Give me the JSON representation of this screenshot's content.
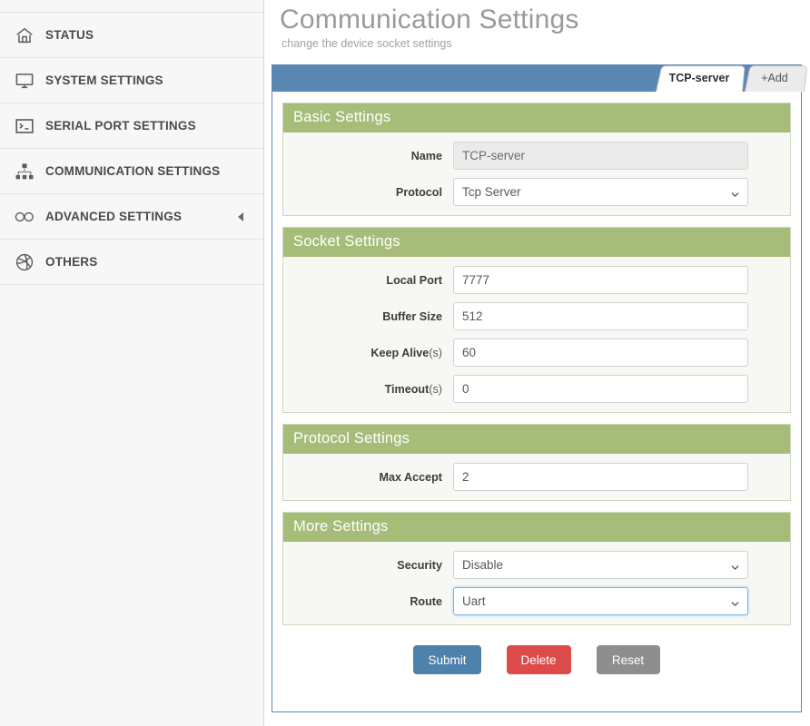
{
  "sidebar": {
    "items": [
      {
        "label": "STATUS",
        "icon": "home-icon",
        "caret": false
      },
      {
        "label": "SYSTEM SETTINGS",
        "icon": "monitor-icon",
        "caret": false
      },
      {
        "label": "SERIAL PORT SETTINGS",
        "icon": "terminal-icon",
        "caret": false
      },
      {
        "label": "COMMUNICATION SETTINGS",
        "icon": "sitemap-icon",
        "caret": false
      },
      {
        "label": "ADVANCED SETTINGS",
        "icon": "infinity-icon",
        "caret": true
      },
      {
        "label": "OTHERS",
        "icon": "dribbble-ball-icon",
        "caret": false
      }
    ]
  },
  "header": {
    "title": "Communication Settings",
    "subtitle": "change the device socket settings"
  },
  "tabs": [
    {
      "label": "TCP-server",
      "active": true
    },
    {
      "label": "+Add",
      "active": false
    }
  ],
  "sections": [
    {
      "title": "Basic Settings",
      "fields": [
        {
          "label": "Name",
          "unit": "",
          "type": "text",
          "value": "TCP-server",
          "disabled": true,
          "focused": false
        },
        {
          "label": "Protocol",
          "unit": "",
          "type": "select",
          "value": "Tcp Server",
          "disabled": false,
          "focused": false
        }
      ]
    },
    {
      "title": "Socket Settings",
      "fields": [
        {
          "label": "Local Port",
          "unit": "",
          "type": "text",
          "value": "7777",
          "disabled": false,
          "focused": false
        },
        {
          "label": "Buffer Size",
          "unit": "",
          "type": "text",
          "value": "512",
          "disabled": false,
          "focused": false
        },
        {
          "label": "Keep Alive",
          "unit": "(s)",
          "type": "text",
          "value": "60",
          "disabled": false,
          "focused": false
        },
        {
          "label": "Timeout",
          "unit": "(s)",
          "type": "text",
          "value": "0",
          "disabled": false,
          "focused": false
        }
      ]
    },
    {
      "title": "Protocol Settings",
      "fields": [
        {
          "label": "Max Accept",
          "unit": "",
          "type": "text",
          "value": "2",
          "disabled": false,
          "focused": false
        }
      ]
    },
    {
      "title": "More Settings",
      "fields": [
        {
          "label": "Security",
          "unit": "",
          "type": "select",
          "value": "Disable",
          "disabled": false,
          "focused": false
        },
        {
          "label": "Route",
          "unit": "",
          "type": "select",
          "value": "Uart",
          "disabled": false,
          "focused": true
        }
      ]
    }
  ],
  "buttons": [
    {
      "label": "Submit",
      "kind": "submit"
    },
    {
      "label": "Delete",
      "kind": "delete"
    },
    {
      "label": "Reset",
      "kind": "reset"
    }
  ],
  "colors": {
    "accent_blue": "#5b87b5",
    "section_green": "#a6bd79",
    "submit": "#4f81ad",
    "delete": "#dd4b4b",
    "reset": "#8e8e8e",
    "sidebar_bg": "#f7f7f7"
  }
}
